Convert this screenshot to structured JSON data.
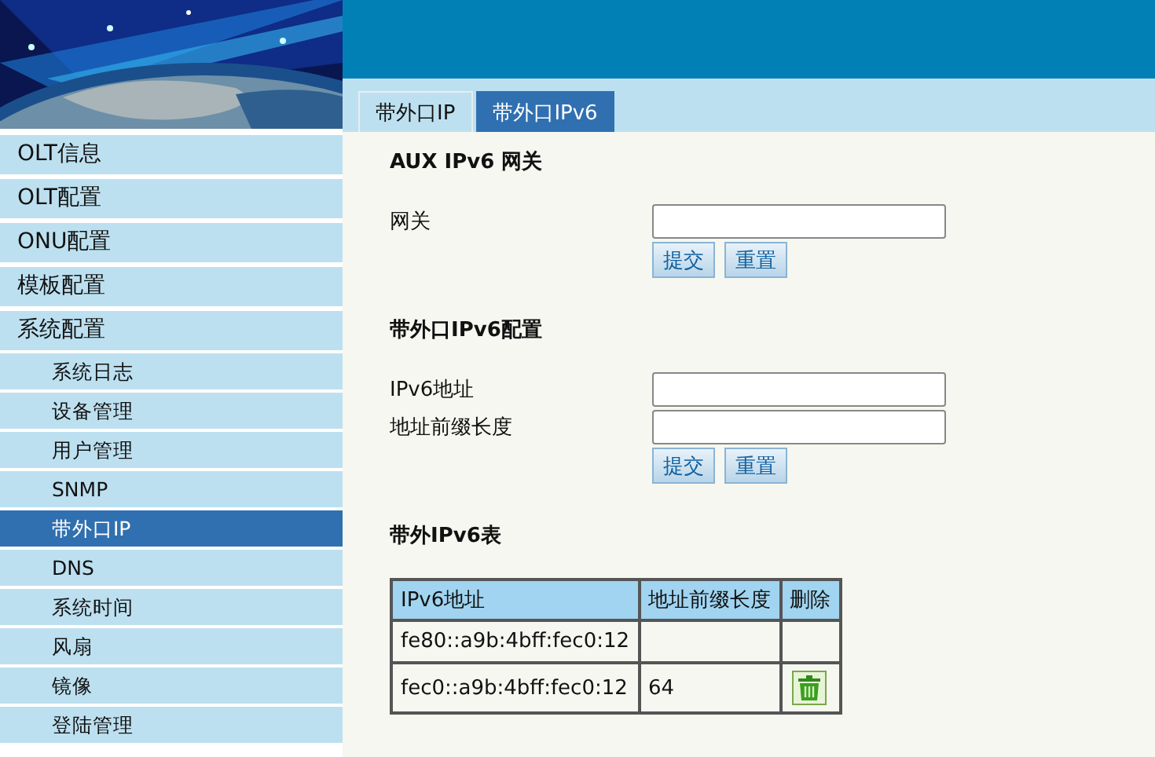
{
  "tabs": [
    {
      "label": "带外口IP",
      "selected": false
    },
    {
      "label": "带外口IPv6",
      "selected": true
    }
  ],
  "sidebar": {
    "items": [
      {
        "label": "OLT信息",
        "selected": false
      },
      {
        "label": "OLT配置",
        "selected": false
      },
      {
        "label": "ONU配置",
        "selected": false
      },
      {
        "label": "模板配置",
        "selected": false
      },
      {
        "label": "系统配置",
        "selected": false,
        "children": [
          {
            "label": "系统日志",
            "selected": false
          },
          {
            "label": "设备管理",
            "selected": false
          },
          {
            "label": "用户管理",
            "selected": false
          },
          {
            "label": "SNMP",
            "selected": false
          },
          {
            "label": "带外口IP",
            "selected": true
          },
          {
            "label": "DNS",
            "selected": false
          },
          {
            "label": "系统时间",
            "selected": false
          },
          {
            "label": "风扇",
            "selected": false
          },
          {
            "label": "镜像",
            "selected": false
          },
          {
            "label": "登陆管理",
            "selected": false
          }
        ]
      }
    ]
  },
  "sections": [
    {
      "title": "AUX IPv6 网关",
      "fields": [
        {
          "label": "网关"
        }
      ],
      "buttons": [
        "提交",
        "重置"
      ]
    },
    {
      "title": "带外口IPv6配置",
      "fields": [
        {
          "label": "IPv6地址"
        },
        {
          "label": "地址前缀长度"
        }
      ],
      "buttons": [
        "提交",
        "重置"
      ]
    }
  ],
  "table": {
    "title": "带外IPv6表",
    "columns": [
      "IPv6地址",
      "地址前缀长度",
      "删除"
    ],
    "rows": [
      {
        "address": "fe80::a9b:4bff:fec0:12",
        "deletable": false
      },
      {
        "address": "fec0::a9b:4bff:fec0:12",
        "prefix_length": "64",
        "deletable": true
      }
    ]
  }
}
